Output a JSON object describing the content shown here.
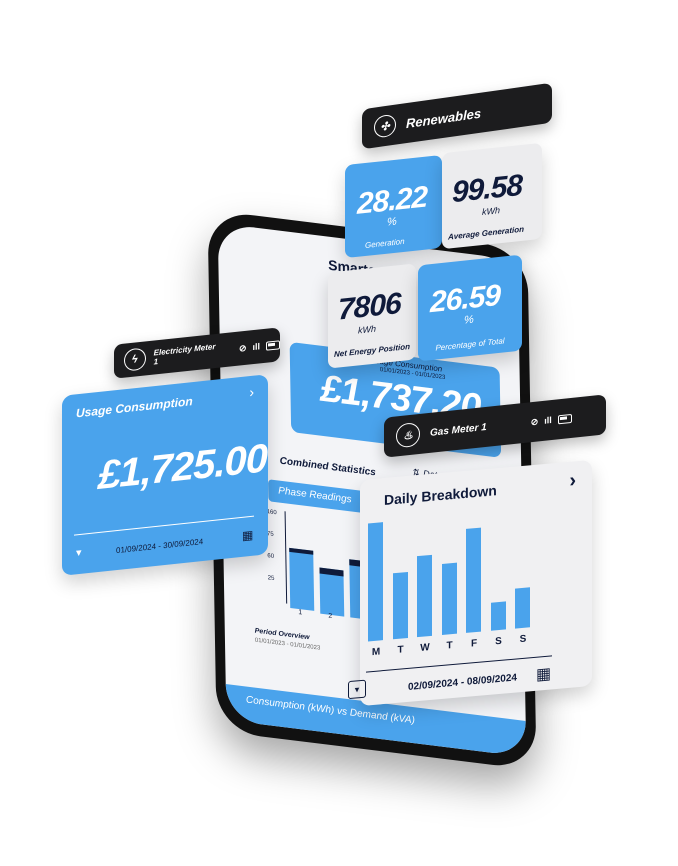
{
  "renewables": {
    "title": "Renewables",
    "icon": "wind-turbine-icon",
    "generation": {
      "value": "28.22",
      "unit": "%",
      "label": "Generation"
    },
    "average_generation": {
      "value": "99.58",
      "unit": "kWh",
      "label": "Average Generation"
    },
    "net_energy_position": {
      "value": "7806",
      "unit": "kWh",
      "label": "Net Energy Position"
    },
    "percentage_of_total": {
      "value": "26.59",
      "unit": "%",
      "label": "Percentage of Total"
    }
  },
  "phone": {
    "app_title": "Smarterview",
    "usage_consumption_label": "Usage Consumption",
    "usage_range": "01/01/2023 - 01/01/2023",
    "usage_value": "£1,737.20",
    "combined_statistics": "Combined Statistics",
    "data_range": "Data Range",
    "phase_readings": "Phase Readings",
    "y_ticks": [
      "160",
      "75",
      "60",
      "25"
    ],
    "x_ticks": [
      "1",
      "2"
    ],
    "period_overview": "Period Overview",
    "period_range": "01/01/2023 - 01/01/2023",
    "footer_tab": "Consumption (kWh) vs Demand (kVA)"
  },
  "electricity_meter": {
    "title": "Electricity Meter 1",
    "icon": "lightning-icon",
    "card_title": "Usage Consumption",
    "value": "£1,725.00",
    "date_range": "01/09/2024 - 30/09/2024"
  },
  "gas_meter": {
    "title": "Gas Meter 1",
    "icon": "flame-icon",
    "card_title": "Daily Breakdown",
    "date_range": "02/09/2024 - 08/09/2024"
  },
  "chart_data": {
    "type": "bar",
    "title": "Daily Breakdown",
    "categories": [
      "M",
      "T",
      "W",
      "T",
      "F",
      "S",
      "S"
    ],
    "values": [
      100,
      56,
      69,
      60,
      88,
      24,
      34
    ],
    "ylim": [
      0,
      100
    ]
  },
  "colors": {
    "accent": "#4aa3ec",
    "dark": "#1c1c1e",
    "navy": "#0f1a3a"
  }
}
